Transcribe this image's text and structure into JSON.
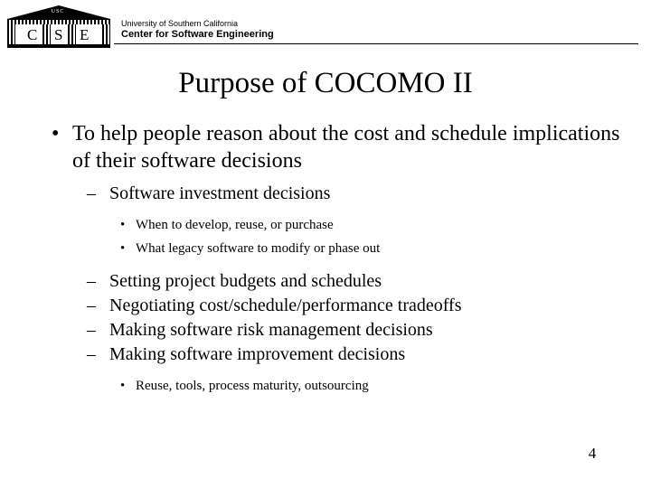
{
  "header": {
    "logo": {
      "arch_text": "USC",
      "letters": [
        "C",
        "S",
        "E"
      ]
    },
    "org_line1": "University of Southern California",
    "org_line2": "Center for Software Engineering"
  },
  "slide": {
    "title": "Purpose of COCOMO II",
    "page_number": "4",
    "bullets": {
      "dot": "•",
      "dash": "–"
    },
    "level1": "To help people reason about the cost and schedule implications of their software decisions",
    "level2_first": "Software investment decisions",
    "level3_first": [
      "When to develop, reuse, or purchase",
      "What legacy software to modify or phase out"
    ],
    "level2_rest": [
      "Setting project budgets and schedules",
      "Negotiating cost/schedule/performance tradeoffs",
      "Making software risk management decisions",
      "Making software improvement decisions"
    ],
    "level3_last": "Reuse, tools, process maturity, outsourcing"
  }
}
